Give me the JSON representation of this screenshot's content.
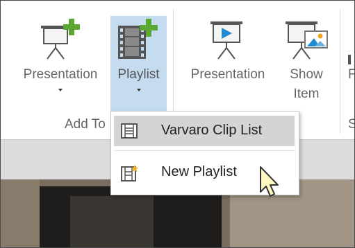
{
  "ribbon": {
    "buttons": [
      {
        "label": "Presentation",
        "icon": "add-presentation-icon",
        "has_dropdown": true
      },
      {
        "label": "Playlist",
        "icon": "add-playlist-icon",
        "has_dropdown": true,
        "active": true
      },
      {
        "label": "Presentation",
        "icon": "present-presentation-icon",
        "has_dropdown": false
      },
      {
        "label_line1": "Show",
        "label_line2": "Item",
        "icon": "show-item-icon",
        "has_dropdown": false
      }
    ],
    "group_label": "Add To",
    "partial_right_labels": [
      "F",
      "S"
    ]
  },
  "menu": {
    "items": [
      {
        "label": "Varvaro Clip List",
        "icon": "playlist-icon",
        "hover": true
      },
      {
        "label": "New Playlist",
        "icon": "new-playlist-icon",
        "hover": false
      }
    ]
  },
  "colors": {
    "active_button_bg": "#c5dcf0",
    "hover_item_bg": "#d4d4d4",
    "plus_green": "#5aa832",
    "play_blue": "#1e8cd2"
  }
}
